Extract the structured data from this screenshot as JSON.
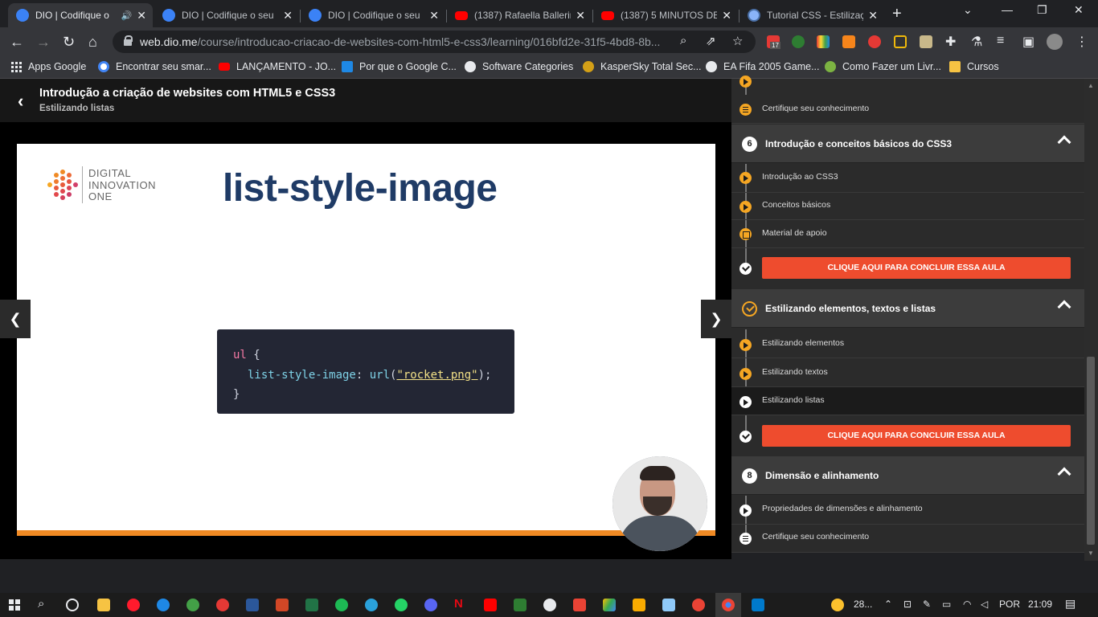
{
  "tabs": [
    {
      "title": "DIO | Codifique o",
      "active": true
    },
    {
      "title": "DIO | Codifique o seu"
    },
    {
      "title": "DIO | Codifique o seu"
    },
    {
      "title": "(1387) Rafaella Ballerin"
    },
    {
      "title": "(1387) 5 MINUTOS DE"
    },
    {
      "title": "Tutorial CSS - Estilizaç"
    }
  ],
  "url": {
    "host": "web.dio.me",
    "path": "/course/introducao-criacao-de-websites-com-html5-e-css3/learning/016bfd2e-31f5-4bd8-8b..."
  },
  "bookmarks": [
    "Apps Google",
    "Encontrar seu smar...",
    "LANÇAMENTO - JO...",
    "Por que o Google C...",
    "Software Categories",
    "KasperSky Total Sec...",
    "EA Fifa 2005 Game...",
    "Como Fazer um Livr...",
    "Cursos"
  ],
  "extension_badge": "17",
  "course": {
    "title": "Introdução a criação de websites com HTML5 e CSS3",
    "lesson": "Estilizando listas"
  },
  "slide": {
    "logo_lines": [
      "DIGITAL",
      "INNOVATION",
      "ONE"
    ],
    "title": "list-style-image",
    "code_line1_kw": "ul",
    "code_line1_brace": " {",
    "code_line2_prop": "list-style-image",
    "code_line2_colon": ": ",
    "code_line2_fn": "url",
    "code_line2_open": "(",
    "code_line2_str": "\"rocket.png\"",
    "code_line2_close": ");",
    "code_line3": "}"
  },
  "sidebar": {
    "top_items": [
      {
        "label": "Certifique seu conhecimento"
      }
    ],
    "section6": {
      "number": "6",
      "title": "Introdução e conceitos básicos do CSS3",
      "items": [
        "Introdução ao CSS3",
        "Conceitos básicos",
        "Material de apoio"
      ],
      "conclude": "CLIQUE AQUI PARA CONCLUIR ESSA AULA"
    },
    "section7": {
      "title": "Estilizando elementos, textos e listas",
      "items": [
        "Estilizando elementos",
        "Estilizando textos",
        "Estilizando listas"
      ],
      "conclude": "CLIQUE AQUI PARA CONCLUIR ESSA AULA"
    },
    "section8": {
      "number": "8",
      "title": "Dimensão e alinhamento",
      "items": [
        "Propriedades de dimensões e alinhamento",
        "Certifique seu conhecimento"
      ]
    }
  },
  "taskbar": {
    "weather": "28...",
    "language": "POR",
    "time": "21:09"
  },
  "colors": {
    "accent_orange": "#f5a623",
    "conclude_red": "#ee4c2e",
    "slide_title": "#1f3b66"
  }
}
